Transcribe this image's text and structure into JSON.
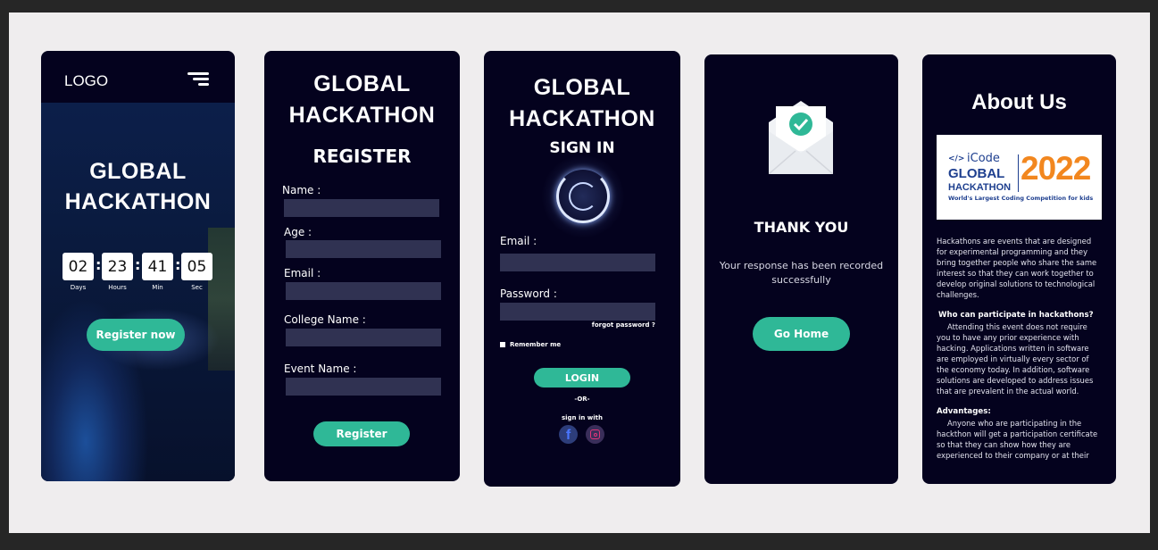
{
  "landing": {
    "logo": "LOGO",
    "title_line1": "GLOBAL",
    "title_line2": "HACKATHON",
    "countdown": [
      {
        "value": "02",
        "unit": "Days"
      },
      {
        "value": "23",
        "unit": "Hours"
      },
      {
        "value": "41",
        "unit": "Min"
      },
      {
        "value": "05",
        "unit": "Sec"
      }
    ],
    "cta": "Register now"
  },
  "register": {
    "title_line1": "GLOBAL",
    "title_line2": "HACKATHON",
    "heading": "REGISTER",
    "fields": [
      "Name :",
      "Age :",
      "Email :",
      "College Name :",
      "Event Name :"
    ],
    "submit": "Register"
  },
  "signin": {
    "title_line1": "GLOBAL",
    "title_line2": "HACKATHON",
    "heading": "SIGN IN",
    "email_label": "Email :",
    "password_label": "Password :",
    "forgot": "forgot password ?",
    "remember": "Remember me",
    "login": "LOGIN",
    "or": "-OR-",
    "social_label": "sign in with"
  },
  "thanks": {
    "heading": "THANK YOU",
    "message_line1": "Your response has been recorded",
    "message_line2": "successfully",
    "button": "Go Home"
  },
  "about": {
    "heading": "About Us",
    "logo_brand": "iCode",
    "logo_title1": "GLOBAL",
    "logo_title2": "HACKATHON",
    "logo_year": "2022",
    "logo_tagline": "World's Largest Coding Competition for kids",
    "para1": "Hackathons are events that are designed for experimental programming and they bring together people who share the same interest so that they can work together to develop original solutions to technological challenges.",
    "q_heading": "Who can participate in hackathons?",
    "para2": "Attending this event does not require you to have any prior experience with hacking. Applications written in software are employed in virtually every sector of the economy today. In addition, software solutions are developed to address issues that are prevalent in the actual world.",
    "adv_heading": "Advantages:",
    "para3": "Anyone who are participating in the hackthon will get a participation certificate so that they can show how they are experienced to their company or at their"
  },
  "colors": {
    "card_bg": "#04021e",
    "accent": "#2fb897",
    "field": "#303252",
    "year_orange": "#f2871f",
    "brand_blue": "#1e3f8f"
  }
}
